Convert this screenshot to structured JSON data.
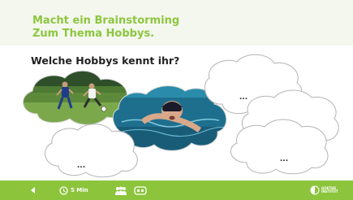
{
  "slide": {
    "title_line1": "Macht ein Brainstorming",
    "title_line2": "Zum Thema Hobbys.",
    "question": "Welche Hobbys kennt ihr?"
  },
  "clouds": [
    {
      "kind": "photo",
      "subject": "football-players-on-grass",
      "label": ""
    },
    {
      "kind": "photo",
      "subject": "swimmer-in-pool",
      "label": ""
    },
    {
      "kind": "placeholder",
      "label": "..."
    },
    {
      "kind": "placeholder",
      "label": "..."
    },
    {
      "kind": "placeholder",
      "label": "..."
    },
    {
      "kind": "placeholder",
      "label": "..."
    }
  ],
  "bottom_bar": {
    "back_icon": "triangle-left-icon",
    "timer_icon": "clock-icon",
    "timer_label": "5 Min",
    "group_icon": "group-icon",
    "pair_icon": "pair-icon",
    "logo_icon": "goethe-institut-logo-icon",
    "logo_line1": "GOETHE",
    "logo_line2": "INSTITUT"
  },
  "colors": {
    "accent": "#8dc63f",
    "bar": "#8cc43c",
    "title_band": "#f4f7ee",
    "cloud_outline": "#b4b4b4",
    "text": "#222222"
  }
}
